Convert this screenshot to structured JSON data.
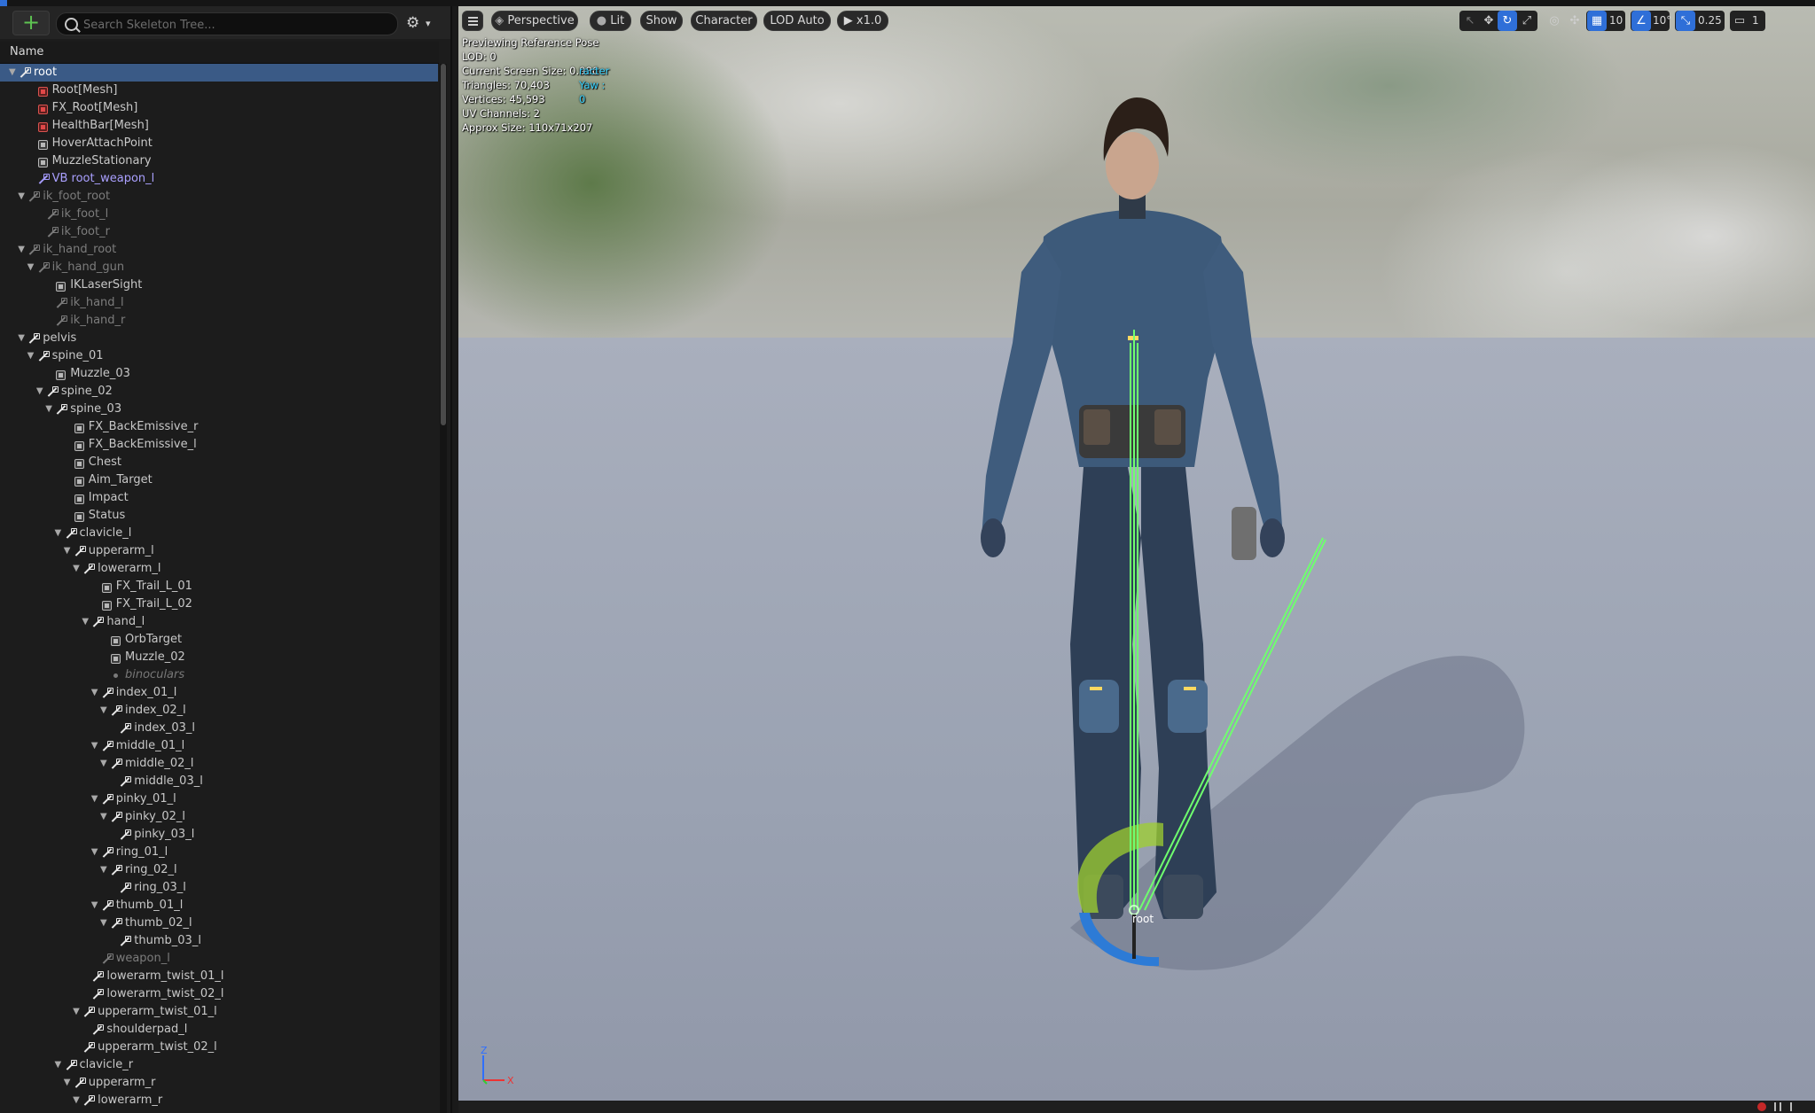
{
  "toolbar": {
    "add_label": "+",
    "search_placeholder": "Search Skeleton Tree..."
  },
  "tree": {
    "column_header": "Name",
    "rows": [
      {
        "label": "root",
        "icon": "bone",
        "depth": 0,
        "chev": true,
        "selected": true
      },
      {
        "label": "Root",
        "suffix": "[Mesh]",
        "icon": "mesh",
        "depth": 2
      },
      {
        "label": "FX_Root",
        "suffix": "[Mesh]",
        "icon": "mesh",
        "depth": 2
      },
      {
        "label": "HealthBar",
        "suffix": "[Mesh]",
        "icon": "mesh",
        "depth": 2
      },
      {
        "label": "HoverAttachPoint",
        "icon": "socket",
        "depth": 2
      },
      {
        "label": "MuzzleStationary",
        "icon": "socket",
        "depth": 2
      },
      {
        "label": "VB root_weapon_l",
        "icon": "bone-vb",
        "depth": 2,
        "style": "vb"
      },
      {
        "label": "ik_foot_root",
        "icon": "bone-dim",
        "depth": 1,
        "chev": true,
        "style": "dim"
      },
      {
        "label": "ik_foot_l",
        "icon": "bone-dim",
        "depth": 3,
        "style": "dim"
      },
      {
        "label": "ik_foot_r",
        "icon": "bone-dim",
        "depth": 3,
        "style": "dim"
      },
      {
        "label": "ik_hand_root",
        "icon": "bone-dim",
        "depth": 1,
        "chev": true,
        "style": "dim"
      },
      {
        "label": "ik_hand_gun",
        "icon": "bone-dim",
        "depth": 2,
        "chev": true,
        "style": "dim"
      },
      {
        "label": "IKLaserSight",
        "icon": "socket",
        "depth": 4
      },
      {
        "label": "ik_hand_l",
        "icon": "bone-dim",
        "depth": 4,
        "style": "dim"
      },
      {
        "label": "ik_hand_r",
        "icon": "bone-dim",
        "depth": 4,
        "style": "dim"
      },
      {
        "label": "pelvis",
        "icon": "bone",
        "depth": 1,
        "chev": true
      },
      {
        "label": "spine_01",
        "icon": "bone",
        "depth": 2,
        "chev": true
      },
      {
        "label": "Muzzle_03",
        "icon": "socket",
        "depth": 4
      },
      {
        "label": "spine_02",
        "icon": "bone",
        "depth": 3,
        "chev": true
      },
      {
        "label": "spine_03",
        "icon": "bone",
        "depth": 4,
        "chev": true
      },
      {
        "label": "FX_BackEmissive_r",
        "icon": "socket",
        "depth": 6
      },
      {
        "label": "FX_BackEmissive_l",
        "icon": "socket",
        "depth": 6
      },
      {
        "label": "Chest",
        "icon": "socket",
        "depth": 6
      },
      {
        "label": "Aim_Target",
        "icon": "socket",
        "depth": 6
      },
      {
        "label": "Impact",
        "icon": "socket",
        "depth": 6
      },
      {
        "label": "Status",
        "icon": "socket",
        "depth": 6
      },
      {
        "label": "clavicle_l",
        "icon": "bone",
        "depth": 5,
        "chev": true
      },
      {
        "label": "upperarm_l",
        "icon": "bone",
        "depth": 6,
        "chev": true
      },
      {
        "label": "lowerarm_l",
        "icon": "bone",
        "depth": 7,
        "chev": true
      },
      {
        "label": "FX_Trail_L_01",
        "icon": "socket",
        "depth": 9
      },
      {
        "label": "FX_Trail_L_02",
        "icon": "socket",
        "depth": 9
      },
      {
        "label": "hand_l",
        "icon": "bone",
        "depth": 8,
        "chev": true
      },
      {
        "label": "OrbTarget",
        "icon": "socket",
        "depth": 10
      },
      {
        "label": "Muzzle_02",
        "icon": "socket",
        "depth": 10
      },
      {
        "label": "binoculars",
        "icon": "dot",
        "depth": 10,
        "style": "italic"
      },
      {
        "label": "index_01_l",
        "icon": "bone",
        "depth": 9,
        "chev": true
      },
      {
        "label": "index_02_l",
        "icon": "bone",
        "depth": 10,
        "chev": true
      },
      {
        "label": "index_03_l",
        "icon": "bone",
        "depth": 11
      },
      {
        "label": "middle_01_l",
        "icon": "bone",
        "depth": 9,
        "chev": true
      },
      {
        "label": "middle_02_l",
        "icon": "bone",
        "depth": 10,
        "chev": true
      },
      {
        "label": "middle_03_l",
        "icon": "bone",
        "depth": 11
      },
      {
        "label": "pinky_01_l",
        "icon": "bone",
        "depth": 9,
        "chev": true
      },
      {
        "label": "pinky_02_l",
        "icon": "bone",
        "depth": 10,
        "chev": true
      },
      {
        "label": "pinky_03_l",
        "icon": "bone",
        "depth": 11
      },
      {
        "label": "ring_01_l",
        "icon": "bone",
        "depth": 9,
        "chev": true
      },
      {
        "label": "ring_02_l",
        "icon": "bone",
        "depth": 10,
        "chev": true
      },
      {
        "label": "ring_03_l",
        "icon": "bone",
        "depth": 11
      },
      {
        "label": "thumb_01_l",
        "icon": "bone",
        "depth": 9,
        "chev": true
      },
      {
        "label": "thumb_02_l",
        "icon": "bone",
        "depth": 10,
        "chev": true
      },
      {
        "label": "thumb_03_l",
        "icon": "bone",
        "depth": 11
      },
      {
        "label": "weapon_l",
        "icon": "bone-dim",
        "depth": 9,
        "style": "dim"
      },
      {
        "label": "lowerarm_twist_01_l",
        "icon": "bone",
        "depth": 8
      },
      {
        "label": "lowerarm_twist_02_l",
        "icon": "bone",
        "depth": 8
      },
      {
        "label": "upperarm_twist_01_l",
        "icon": "bone",
        "depth": 7,
        "chev": true
      },
      {
        "label": "shoulderpad_l",
        "icon": "bone",
        "depth": 8
      },
      {
        "label": "upperarm_twist_02_l",
        "icon": "bone",
        "depth": 7
      },
      {
        "label": "clavicle_r",
        "icon": "bone",
        "depth": 5,
        "chev": true
      },
      {
        "label": "upperarm_r",
        "icon": "bone",
        "depth": 6,
        "chev": true
      },
      {
        "label": "lowerarm_r",
        "icon": "bone",
        "depth": 7,
        "chev": true
      }
    ]
  },
  "viewport": {
    "toolbar": {
      "perspective": "Perspective",
      "lit": "Lit",
      "show": "Show",
      "character": "Character",
      "lod": "LOD Auto",
      "speed": "x1.0",
      "grid_snap": "10",
      "rot_snap": "10°",
      "scale_snap": "0.25",
      "camera_speed": "1"
    },
    "stats": {
      "line1": "Previewing Reference Pose",
      "line2": "LOD: 0",
      "line3": "Current Screen Size: 0.986",
      "line3_overlay": "racter Yaw : 0",
      "line4": "Triangles: 70,403",
      "line5": "Vertices: 45,593",
      "line6": "UV Channels: 2",
      "line7": "Approx Size: 110x71x207"
    },
    "bone_label": "root",
    "axis": {
      "z": "Z",
      "x": "X"
    },
    "colors": {
      "bone": "#6fff6f",
      "accent": "#2f6fd8",
      "selection": "#3a5a86"
    }
  }
}
